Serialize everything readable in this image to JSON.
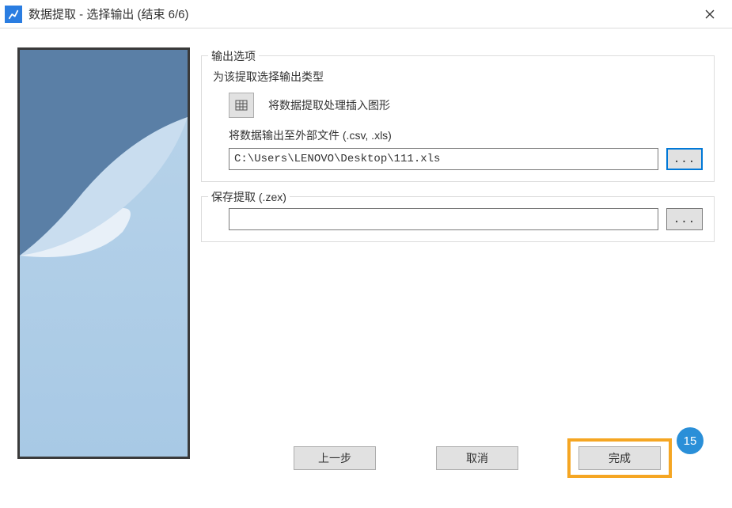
{
  "window": {
    "title": "数据提取 - 选择输出 (结束 6/6)"
  },
  "output_options": {
    "legend": "输出选项",
    "subtitle": "为该提取选择输出类型",
    "insert_label": "将数据提取处理插入图形",
    "external_label": "将数据输出至外部文件 (.csv, .xls)",
    "path_value": "C:\\Users\\LENOVO\\Desktop\\111.xls",
    "browse_label": "..."
  },
  "save_extract": {
    "legend": "保存提取 (.zex)",
    "path_value": "",
    "browse_label": "..."
  },
  "footer": {
    "back": "上一步",
    "cancel": "取消",
    "finish": "完成"
  },
  "callout": {
    "number": "15"
  }
}
